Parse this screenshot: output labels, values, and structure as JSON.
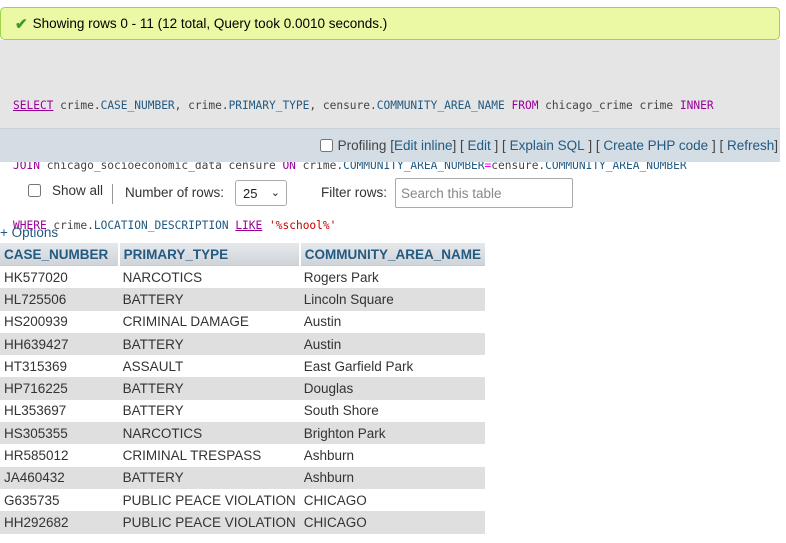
{
  "message": {
    "text": "Showing rows 0 - 11 (12 total, Query took 0.0010 seconds.)",
    "icon": "check-icon"
  },
  "sql": {
    "line1": [
      {
        "t": "SELECT",
        "c": "kw u"
      },
      {
        "t": " crime.",
        "c": ""
      },
      {
        "t": "CASE_NUMBER",
        "c": "fn"
      },
      {
        "t": ", crime.",
        "c": ""
      },
      {
        "t": "PRIMARY_TYPE",
        "c": "fn"
      },
      {
        "t": ", censure.",
        "c": ""
      },
      {
        "t": "COMMUNITY_AREA_NAME",
        "c": "fn"
      },
      {
        "t": " ",
        "c": ""
      },
      {
        "t": "FROM",
        "c": "kw"
      },
      {
        "t": " chicago_crime crime ",
        "c": ""
      },
      {
        "t": "INNER",
        "c": "kw"
      }
    ],
    "line2": [
      {
        "t": "JOIN",
        "c": "kw"
      },
      {
        "t": " chicago_socioeconomic_data censure ",
        "c": ""
      },
      {
        "t": "ON",
        "c": "kw"
      },
      {
        "t": " crime.",
        "c": ""
      },
      {
        "t": "COMMUNITY_AREA_NUMBER",
        "c": "fn"
      },
      {
        "t": "=",
        "c": "op"
      },
      {
        "t": "censure.",
        "c": ""
      },
      {
        "t": "COMMUNITY_AREA_NUMBER",
        "c": "fn"
      }
    ],
    "line3": [
      {
        "t": "WHERE",
        "c": "kw"
      },
      {
        "t": " crime.",
        "c": ""
      },
      {
        "t": "LOCATION_DESCRIPTION",
        "c": "fn"
      },
      {
        "t": " ",
        "c": ""
      },
      {
        "t": "LIKE",
        "c": "kw u"
      },
      {
        "t": " ",
        "c": ""
      },
      {
        "t": "'%school%'",
        "c": "str"
      }
    ]
  },
  "sqlbar": {
    "profiling": "Profiling",
    "edit_inline": "Edit inline",
    "edit": "Edit",
    "explain": "Explain SQL",
    "create_php": "Create PHP code",
    "refresh": "Refresh"
  },
  "controls": {
    "show_all": "Show all",
    "rows_label": "Number of rows:",
    "rows_value": "25",
    "filter_label": "Filter rows:",
    "filter_placeholder": "Search this table"
  },
  "options_link": "+ Options",
  "table": {
    "headers": [
      "CASE_NUMBER",
      "PRIMARY_TYPE",
      "COMMUNITY_AREA_NAME"
    ],
    "rows": [
      [
        "HK577020",
        "NARCOTICS",
        "Rogers Park"
      ],
      [
        "HL725506",
        "BATTERY",
        "Lincoln Square"
      ],
      [
        "HS200939",
        "CRIMINAL DAMAGE",
        "Austin"
      ],
      [
        "HH639427",
        "BATTERY",
        "Austin"
      ],
      [
        "HT315369",
        "ASSAULT",
        "East Garfield Park"
      ],
      [
        "HP716225",
        "BATTERY",
        "Douglas"
      ],
      [
        "HL353697",
        "BATTERY",
        "South Shore"
      ],
      [
        "HS305355",
        "NARCOTICS",
        "Brighton Park"
      ],
      [
        "HR585012",
        "CRIMINAL TRESPASS",
        "Ashburn"
      ],
      [
        "JA460432",
        "BATTERY",
        "Ashburn"
      ],
      [
        "G635735",
        "PUBLIC PEACE VIOLATION",
        "CHICAGO"
      ],
      [
        "HH292682",
        "PUBLIC PEACE VIOLATION",
        "CHICAGO"
      ]
    ]
  }
}
